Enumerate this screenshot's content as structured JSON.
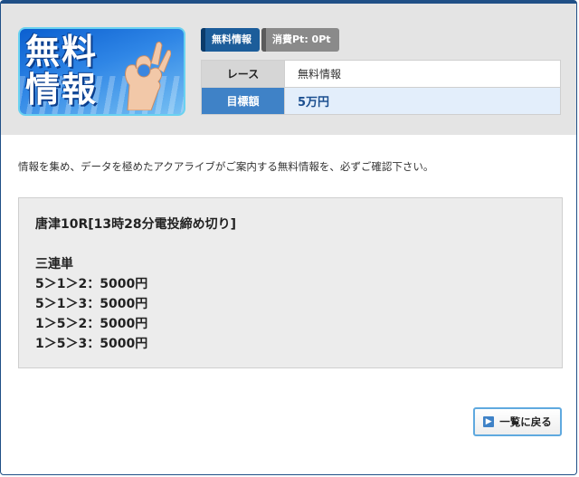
{
  "header": {
    "thumbnail": {
      "logo_text_line1": "無料",
      "logo_text_line2": "情報"
    },
    "badges": {
      "free_info": "無料情報",
      "cost": "消費Pt: 0Pt"
    },
    "table": {
      "race_label": "レース",
      "race_value": "無料情報",
      "target_label": "目標額",
      "target_value": "5万円"
    }
  },
  "intro_text": "情報を集め、データを極めたアクアライブがご案内する無料情報を、必ずご確認下さい。",
  "content": {
    "race": "唐津10R[13時28分電投締め切り]",
    "bet_type": "三連単",
    "picks": [
      "5＞1＞2：5000円",
      "5＞1＞3：5000円",
      "1＞5＞2：5000円",
      "1＞5＞3：5000円"
    ]
  },
  "back_button": {
    "label": "一覧に戻る",
    "icon": "chevron-right-icon"
  },
  "colors": {
    "frame": "#1f4f86",
    "badge_free": "#1c5d9a",
    "badge_cost": "#8a8a8a",
    "target_label_bg": "#3f82c7",
    "target_value_bg": "#e3eefb",
    "button_border": "#5fa9df"
  }
}
